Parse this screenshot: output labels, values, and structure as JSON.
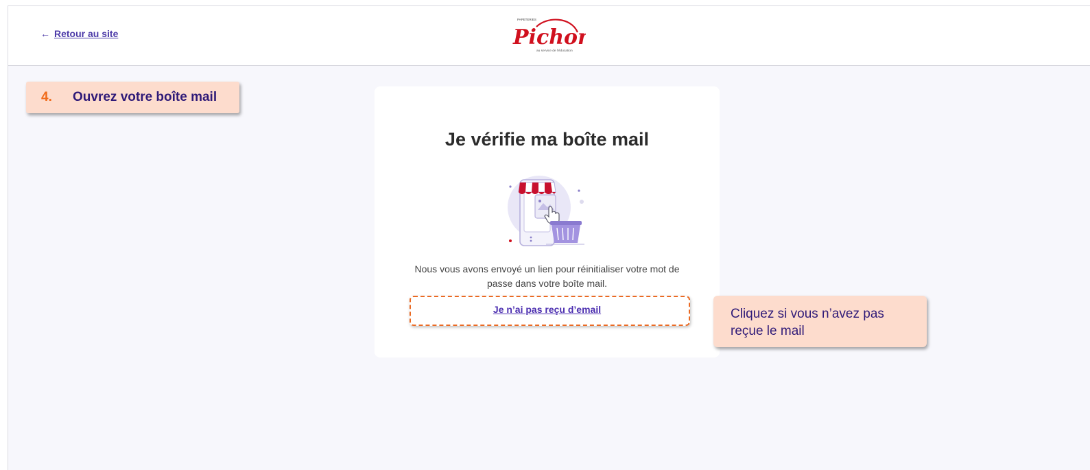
{
  "header": {
    "back_arrow": "←",
    "back_label": "Retour au site",
    "logo_small_top": "PAPETERIES",
    "logo_name": "Pichon",
    "logo_tagline": "au service de l'éducation"
  },
  "annotation": {
    "step_number": "4.",
    "step_label": "Ouvrez votre boîte mail",
    "tip_text": "Cliquez si vous n’avez pas reçue le mail"
  },
  "card": {
    "title": "Je vérifie ma boîte mail",
    "description": "Nous vous avons envoyé un lien pour réinitialiser votre mot de passe dans votre boîte mail.",
    "no_email_link": "Je n’ai pas reçu d’email"
  },
  "colors": {
    "accent": "#4c2fb0",
    "highlight": "#ea6a23",
    "callout_bg": "#fddccd",
    "logo_red": "#d0101e"
  },
  "icons": {
    "illustration": "shop-phone-basket-illustration"
  }
}
